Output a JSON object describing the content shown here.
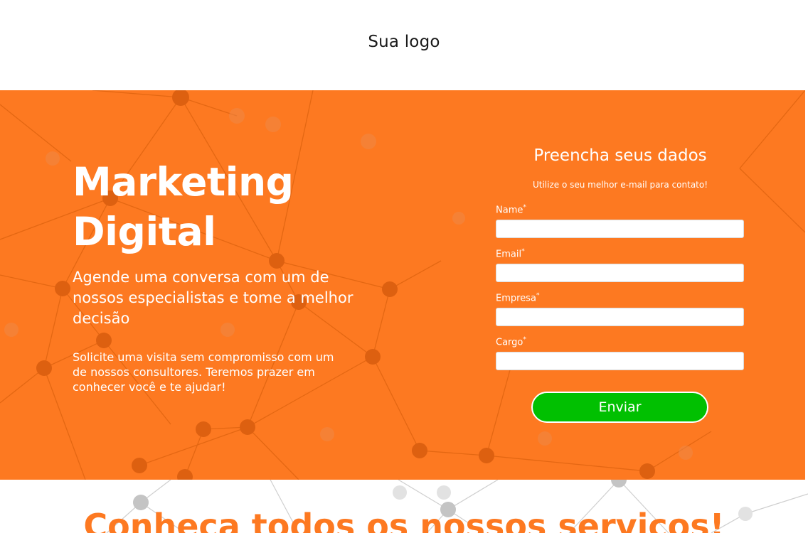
{
  "header": {
    "logo": "Sua logo"
  },
  "hero": {
    "title_line1": "Marketing",
    "title_line2": "Digital",
    "subtitle": "Agende uma conversa com um de nossos especialistas e tome a melhor decisão",
    "description": "Solicite uma visita sem compromisso com um de nossos consultores. Teremos prazer em conhecer você e te ajudar!"
  },
  "form": {
    "title": "Preencha seus dados",
    "note": "Utilize o seu melhor e-mail para contato!",
    "fields": [
      {
        "label": "Name",
        "required_mark": "*",
        "value": ""
      },
      {
        "label": "Email",
        "required_mark": "*",
        "value": ""
      },
      {
        "label": "Empresa",
        "required_mark": "*",
        "value": ""
      },
      {
        "label": "Cargo",
        "required_mark": "*",
        "value": ""
      }
    ],
    "submit_label": "Enviar"
  },
  "services": {
    "title": "Conheça todos os nossos serviços!"
  },
  "colors": {
    "accent": "#fd7921",
    "submit": "#01c001",
    "network_node_light": "#c4c4c4"
  }
}
